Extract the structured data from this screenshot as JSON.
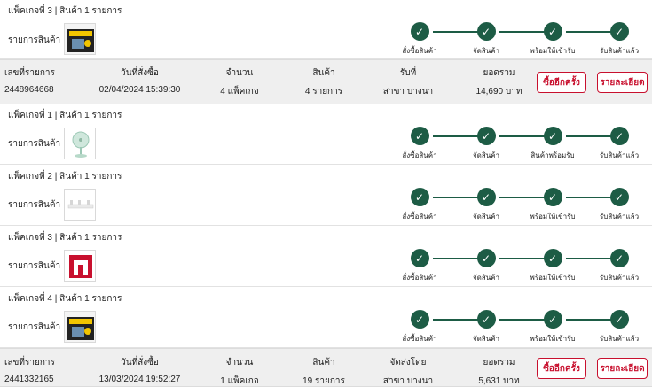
{
  "steps_std": [
    "สั่งซื้อสินค้า",
    "จัดสินค้า",
    "พร้อมให้เข้ารับ",
    "รับสินค้าแล้ว"
  ],
  "steps_alt": [
    "สั่งซื้อสินค้า",
    "จัดสินค้า",
    "สินค้าพร้อมรับ",
    "รับสินค้าแล้ว"
  ],
  "item_label": "รายการสินค้า",
  "pkg_top": {
    "title": "แพ็คเกจที่ 3 | สินค้า 1 รายการ"
  },
  "order1": {
    "headers": [
      "เลขที่รายการ",
      "วันที่สั่งซื้อ",
      "จำนวน",
      "สินค้า",
      "รับที่",
      "ยอดรวม"
    ],
    "values": [
      "2448964668",
      "02/04/2024 15:39:30",
      "4 แพ็คเกจ",
      "4 รายการ",
      "สาขา บางนา",
      "14,690 บาท"
    ],
    "rebuy_label": "ซื้ออีกครั้ง",
    "detail_label": "รายละเอียด"
  },
  "packages": [
    {
      "title": "แพ็คเกจที่ 1 | สินค้า 1 รายการ",
      "thumb": "fan"
    },
    {
      "title": "แพ็คเกจที่ 2 | สินค้า 1 รายการ",
      "thumb": "rail"
    },
    {
      "title": "แพ็คเกจที่ 3 | สินค้า 1 รายการ",
      "thumb": "logo"
    },
    {
      "title": "แพ็คเกจที่ 4 | สินค้า 1 รายการ",
      "thumb": "box"
    }
  ],
  "order2": {
    "headers": [
      "เลขที่รายการ",
      "วันที่สั่งซื้อ",
      "จำนวน",
      "สินค้า",
      "จัดส่งโดย",
      "ยอดรวม"
    ],
    "values": [
      "2441332165",
      "13/03/2024 19:52:27",
      "1 แพ็คเกจ",
      "19 รายการ",
      "สาขา บางนา",
      "5,631 บาท"
    ],
    "rebuy_label": "ซื้ออีกครั้ง",
    "detail_label": "รายละเอียด"
  },
  "colors": {
    "accent_green": "#1d5c45",
    "button_red": "#c8102e",
    "summary_bg": "#efefef"
  }
}
